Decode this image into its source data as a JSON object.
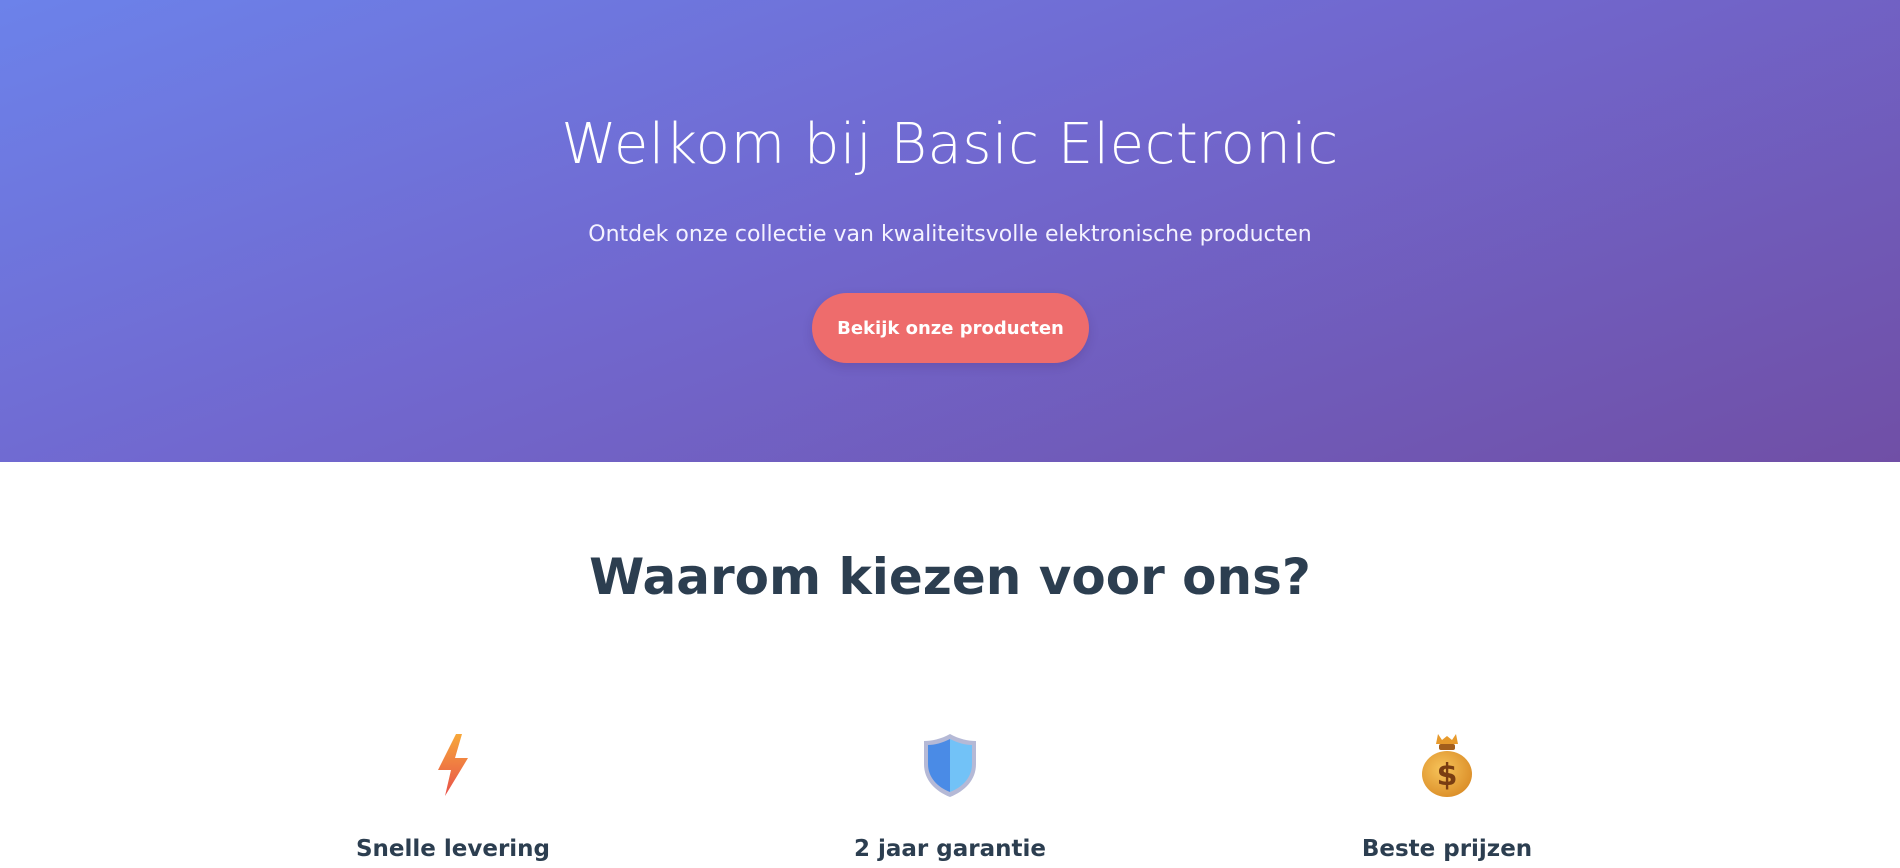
{
  "hero": {
    "title": "Welkom bij Basic Electronic",
    "subtitle": "Ontdek onze collectie van kwaliteitsvolle elektronische producten",
    "cta_label": "Bekijk onze producten",
    "gradient_start": "#6c82ea",
    "gradient_end": "#704fa6",
    "cta_color": "#ee6c6c"
  },
  "why": {
    "title": "Waarom kiezen voor ons?",
    "features": [
      {
        "icon": "lightning-bolt-icon",
        "label": "Snelle levering"
      },
      {
        "icon": "shield-icon",
        "label": "2 jaar garantie"
      },
      {
        "icon": "money-bag-icon",
        "label": "Beste prijzen"
      }
    ]
  }
}
